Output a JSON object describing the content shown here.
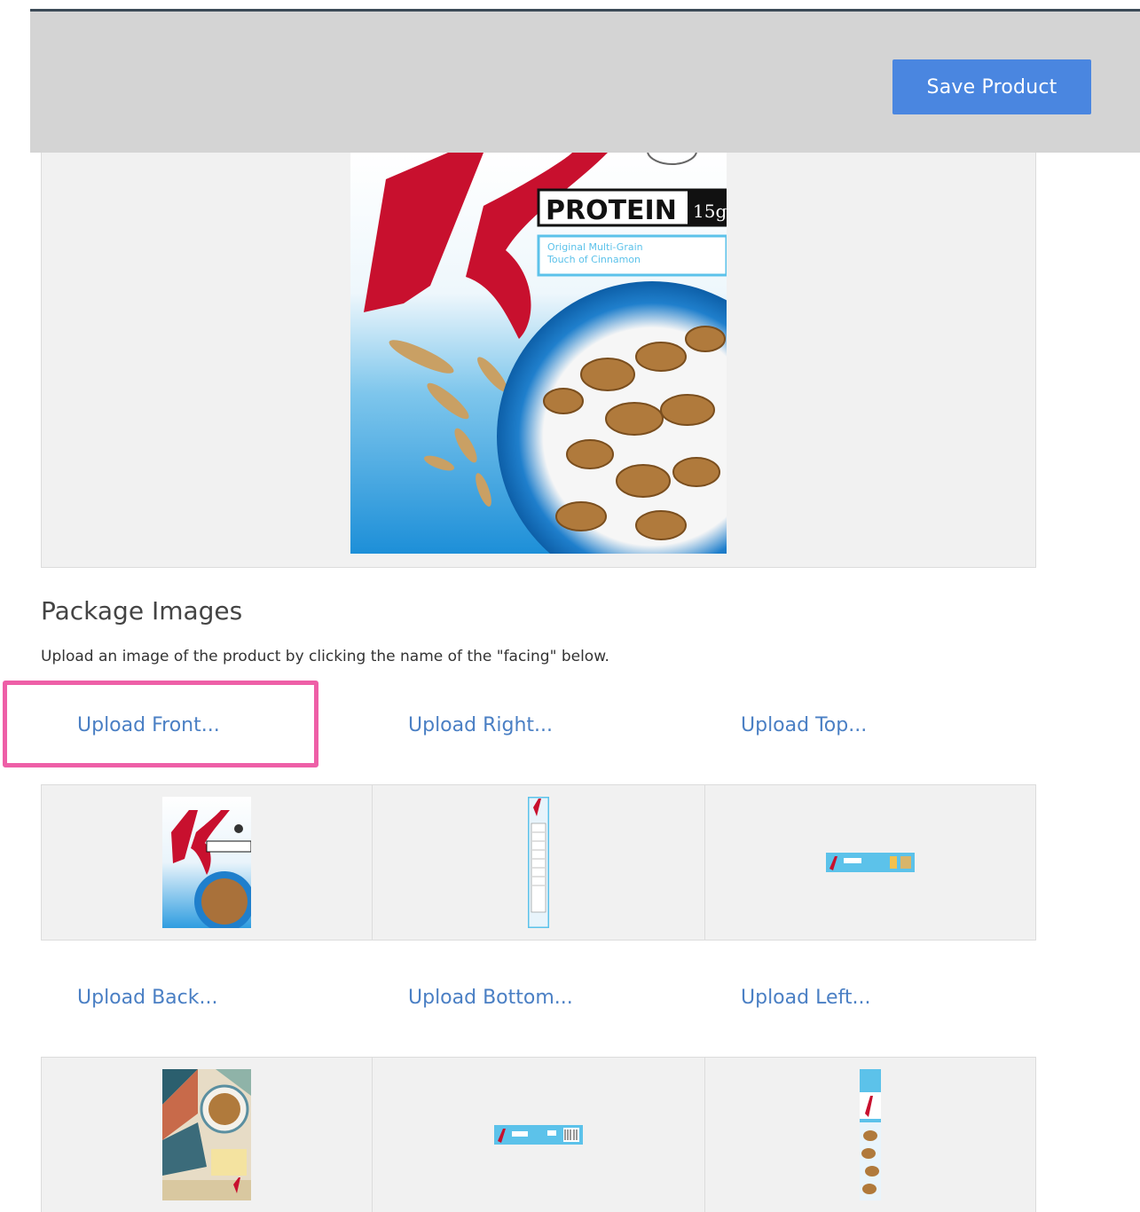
{
  "header": {
    "save_label": "Save Product"
  },
  "preview": {
    "brand_badge": "PROTEIN",
    "badge_grams": "15g",
    "subtitle_1": "Original Multi-Grain",
    "subtitle_2": "Touch of Cinnamon"
  },
  "package_images": {
    "title": "Package Images",
    "description": "Upload an image of the product by clicking the name of the \"facing\" below.",
    "links": {
      "front": "Upload Front...",
      "right": "Upload Right...",
      "top": "Upload Top...",
      "back": "Upload Back...",
      "bottom": "Upload Bottom...",
      "left": "Upload Left..."
    }
  },
  "colors": {
    "header_bg": "#d4d4d4",
    "button": "#4a86e0",
    "link": "#4a7fc4",
    "highlight": "#ee5fa7",
    "brand_red": "#c8102e",
    "box_blue": "#2f9de0"
  }
}
